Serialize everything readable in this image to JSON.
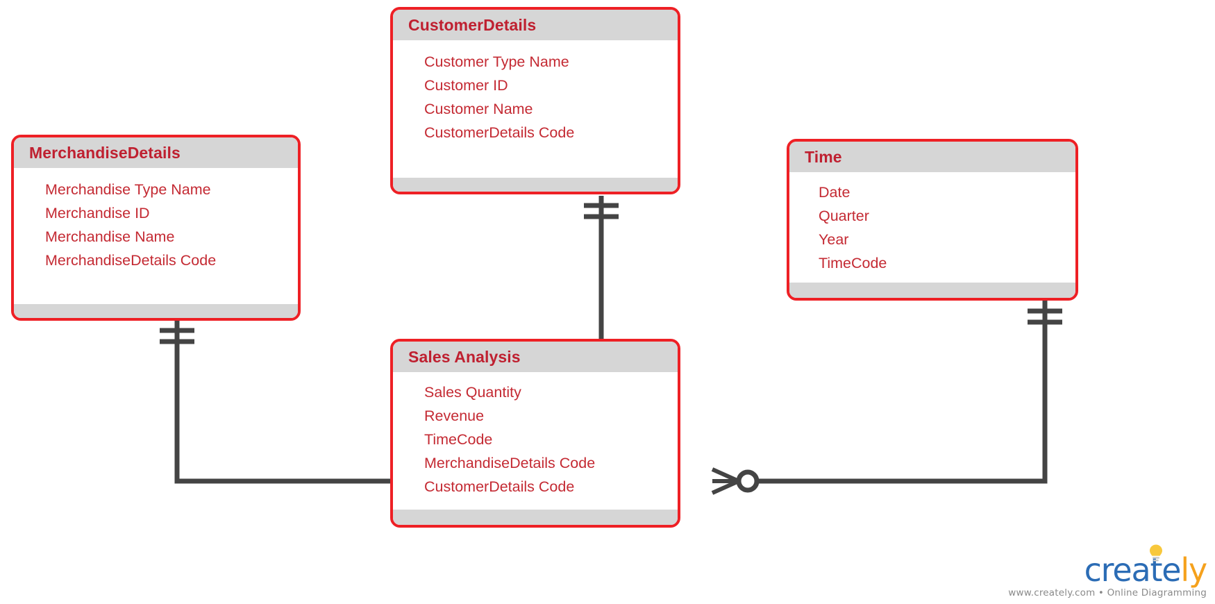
{
  "diagram": {
    "type": "entity-relationship-diagram",
    "notation": "crows-foot",
    "colors": {
      "entity_border": "#ee2025",
      "entity_header_fill": "#d6d6d6",
      "entity_body_fill": "#ffffff",
      "title_text": "#bf2030",
      "attribute_text": "#c42a33",
      "connector": "#444444",
      "background": "#ffffff"
    }
  },
  "entities": [
    {
      "id": "merchandise",
      "title": "MerchandiseDetails",
      "attributes": [
        "Merchandise Type Name",
        "Merchandise ID",
        "Merchandise Name",
        "MerchandiseDetails Code"
      ]
    },
    {
      "id": "customer",
      "title": "CustomerDetails",
      "attributes": [
        "Customer Type Name",
        "Customer ID",
        "Customer Name",
        "CustomerDetails Code"
      ]
    },
    {
      "id": "time",
      "title": "Time",
      "attributes": [
        "Date",
        "Quarter",
        "Year",
        "TimeCode"
      ]
    },
    {
      "id": "sales",
      "title": "Sales Analysis",
      "attributes": [
        "Sales Quantity",
        "Revenue",
        "TimeCode",
        "MerchandiseDetails Code",
        "CustomerDetails Code"
      ]
    }
  ],
  "relationships": [
    {
      "id": "merchandise-sales",
      "from": "MerchandiseDetails",
      "to": "Sales Analysis",
      "from_cardinality": "one-and-only-one",
      "to_cardinality": "zero-or-many"
    },
    {
      "id": "customer-sales",
      "from": "CustomerDetails",
      "to": "Sales Analysis",
      "from_cardinality": "one-and-only-one",
      "to_cardinality": "zero-or-many"
    },
    {
      "id": "time-sales",
      "from": "Time",
      "to": "Sales Analysis",
      "from_cardinality": "one-and-only-one",
      "to_cardinality": "zero-or-many"
    }
  ],
  "watermark": {
    "brand_part1": "creat",
    "brand_part2": "e",
    "brand_part3": "ly",
    "tagline": "www.creately.com • Online Diagramming",
    "brand_color_primary": "#2b6cb5",
    "brand_color_accent": "#f5a11c"
  }
}
